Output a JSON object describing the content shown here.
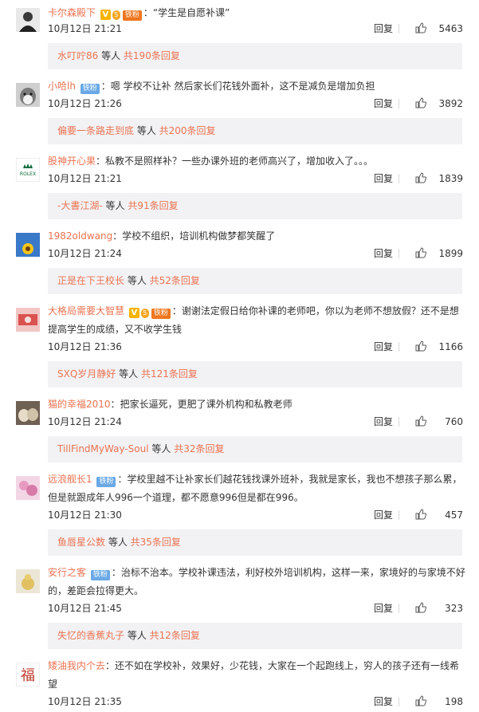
{
  "comments": [
    {
      "user": "卡尔森殿下",
      "badges": [
        "v",
        "fan-orange"
      ],
      "fan_label": "铁粉",
      "text": "“学生是自愿补课”",
      "time": "10月12日 21:21",
      "reply": "回复",
      "likes": "5463",
      "sub_user": "水叮咛86",
      "sub_mid": " 等人 ",
      "sub_count": "共190条回复"
    },
    {
      "user": "小哈lh",
      "badges": [
        "fan-blue"
      ],
      "fan_label": "铁粉",
      "text": "嗯 学校不让补 然后家长们花钱外面补，这不是减负是增加负担",
      "time": "10月12日 21:26",
      "reply": "回复",
      "likes": "3892",
      "sub_user": "偏要一条路走到底",
      "sub_mid": " 等人 ",
      "sub_count": "共200条回复"
    },
    {
      "user": "股神开心果",
      "badges": [],
      "fan_label": "",
      "text": "私教不是照样补？一些办课外班的老师高兴了，增加收入了。。。",
      "time": "10月12日 21:21",
      "reply": "回复",
      "likes": "1839",
      "sub_user": "-大書江湖-",
      "sub_mid": " 等人 ",
      "sub_count": "共91条回复"
    },
    {
      "user": "1982oldwang",
      "badges": [],
      "fan_label": "",
      "text": "学校不组织，培训机构做梦都笑醒了",
      "time": "10月12日 21:24",
      "reply": "回复",
      "likes": "1899",
      "sub_user": "正是在下王校长",
      "sub_mid": " 等人 ",
      "sub_count": "共52条回复"
    },
    {
      "user": "大格局需要大智慧",
      "badges": [
        "v",
        "fan-orange"
      ],
      "fan_label": "铁粉",
      "text": "谢谢法定假日给你补课的老师吧，你以为老师不想放假？还不是想提高学生的成绩，又不收学生钱",
      "time": "10月12日 21:36",
      "reply": "回复",
      "likes": "1166",
      "sub_user": "SXQ岁月静好",
      "sub_mid": " 等人 ",
      "sub_count": "共121条回复"
    },
    {
      "user": "猫的幸福2010",
      "badges": [],
      "fan_label": "",
      "text": "把家长逼死，更肥了课外机构和私教老师",
      "time": "10月12日 21:24",
      "reply": "回复",
      "likes": "760",
      "sub_user": "TillFindMyWay-Soul",
      "sub_mid": " 等人 ",
      "sub_count": "共32条回复"
    },
    {
      "user": "远浪舰长1",
      "badges": [
        "fan-blue"
      ],
      "fan_label": "铁粉",
      "text": "学校里越不让补家长们越花钱找课外班补，我就是家长，我也不想孩子那么累，但是就跟成年人996一个道理，都不愿意996但是都在996。",
      "time": "10月12日 21:30",
      "reply": "回复",
      "likes": "457",
      "sub_user": "鱼唇星公数",
      "sub_mid": " 等人 ",
      "sub_count": "共35条回复"
    },
    {
      "user": "安行之客",
      "badges": [
        "fan-blue"
      ],
      "fan_label": "铁粉",
      "text": "治标不治本。学校补课违法，利好校外培训机构，这样一来，家境好的与家境不好的，差距会拉得更大。",
      "time": "10月12日 21:45",
      "reply": "回复",
      "likes": "323",
      "sub_user": "失忆的香蕉丸子",
      "sub_mid": " 等人 ",
      "sub_count": "共12条回复"
    },
    {
      "user": "矮油我内个去",
      "badges": [],
      "fan_label": "",
      "text": "还不如在学校补，效果好，少花钱，大家在一个起跑线上，穷人的孩子还有一线希望",
      "time": "10月12日 21:35",
      "reply": "回复",
      "likes": "198",
      "sub_user": "",
      "sub_mid": "",
      "sub_count": ""
    }
  ],
  "avatars": [
    "person-dark",
    "dog-husky",
    "rolex-logo",
    "sunflower",
    "red-money",
    "cats-photo",
    "pink-flowers",
    "yellow-chick",
    "fu-character"
  ],
  "fu_glyph": "福",
  "rolex_text": "ROLEX",
  "v_glyph": "V"
}
